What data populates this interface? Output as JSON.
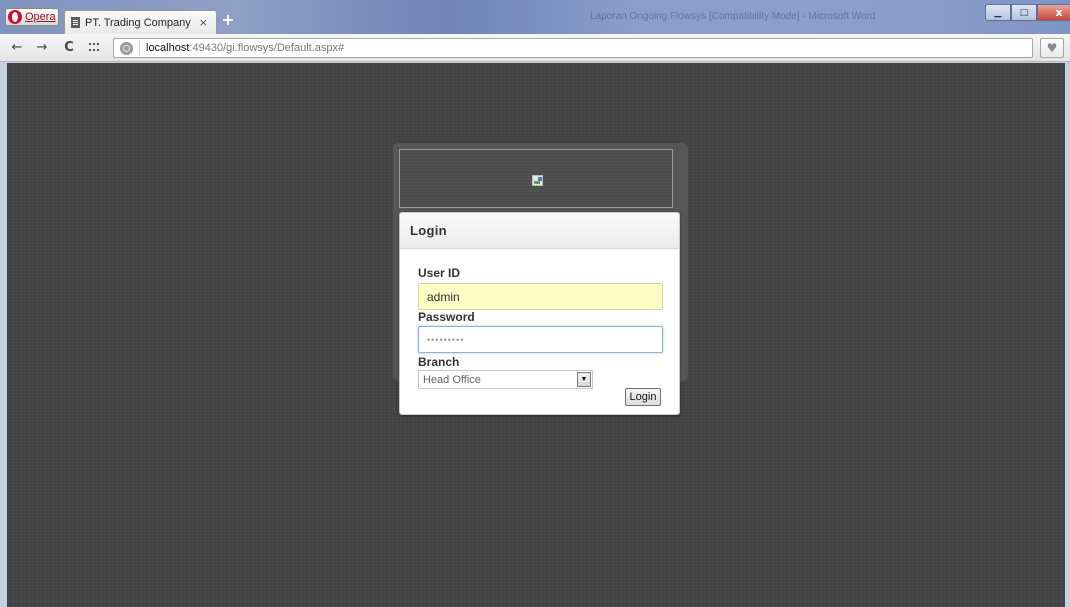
{
  "browser": {
    "menu_label": "Opera",
    "tab": {
      "title": "PT. Trading Company",
      "close_glyph": "×"
    },
    "new_tab_glyph": "+",
    "background_window_title": "Laporan Ongoing Flowsys [Compatibility Mode] - Microsoft Word",
    "nav": {
      "back_glyph": "←",
      "forward_glyph": "→",
      "reload_glyph": "C"
    },
    "address": {
      "host": "localhost",
      "rest": ":49430/gi.flowsys/Default.aspx#"
    },
    "heart_glyph": "♥",
    "window_controls": {
      "minimize_glyph": "▁",
      "maximize_glyph": "□",
      "close_glyph": "x"
    }
  },
  "login": {
    "heading": "Login",
    "user_id_label": "User ID",
    "user_id_value": "admin",
    "password_label": "Password",
    "password_value": "•••••••••",
    "branch_label": "Branch",
    "branch_selected": "Head Office",
    "select_arrow_glyph": "▼",
    "submit_label": "Login"
  },
  "icons": {
    "page": "page-icon",
    "globe": "globe-icon",
    "speed_dial": "speed-dial-icon",
    "broken_image": "broken-image-icon",
    "heart": "heart-icon"
  },
  "colors": {
    "page_background": "#444444",
    "user_id_autofill": "#fcfcc5",
    "opera_red": "#c8102e"
  }
}
